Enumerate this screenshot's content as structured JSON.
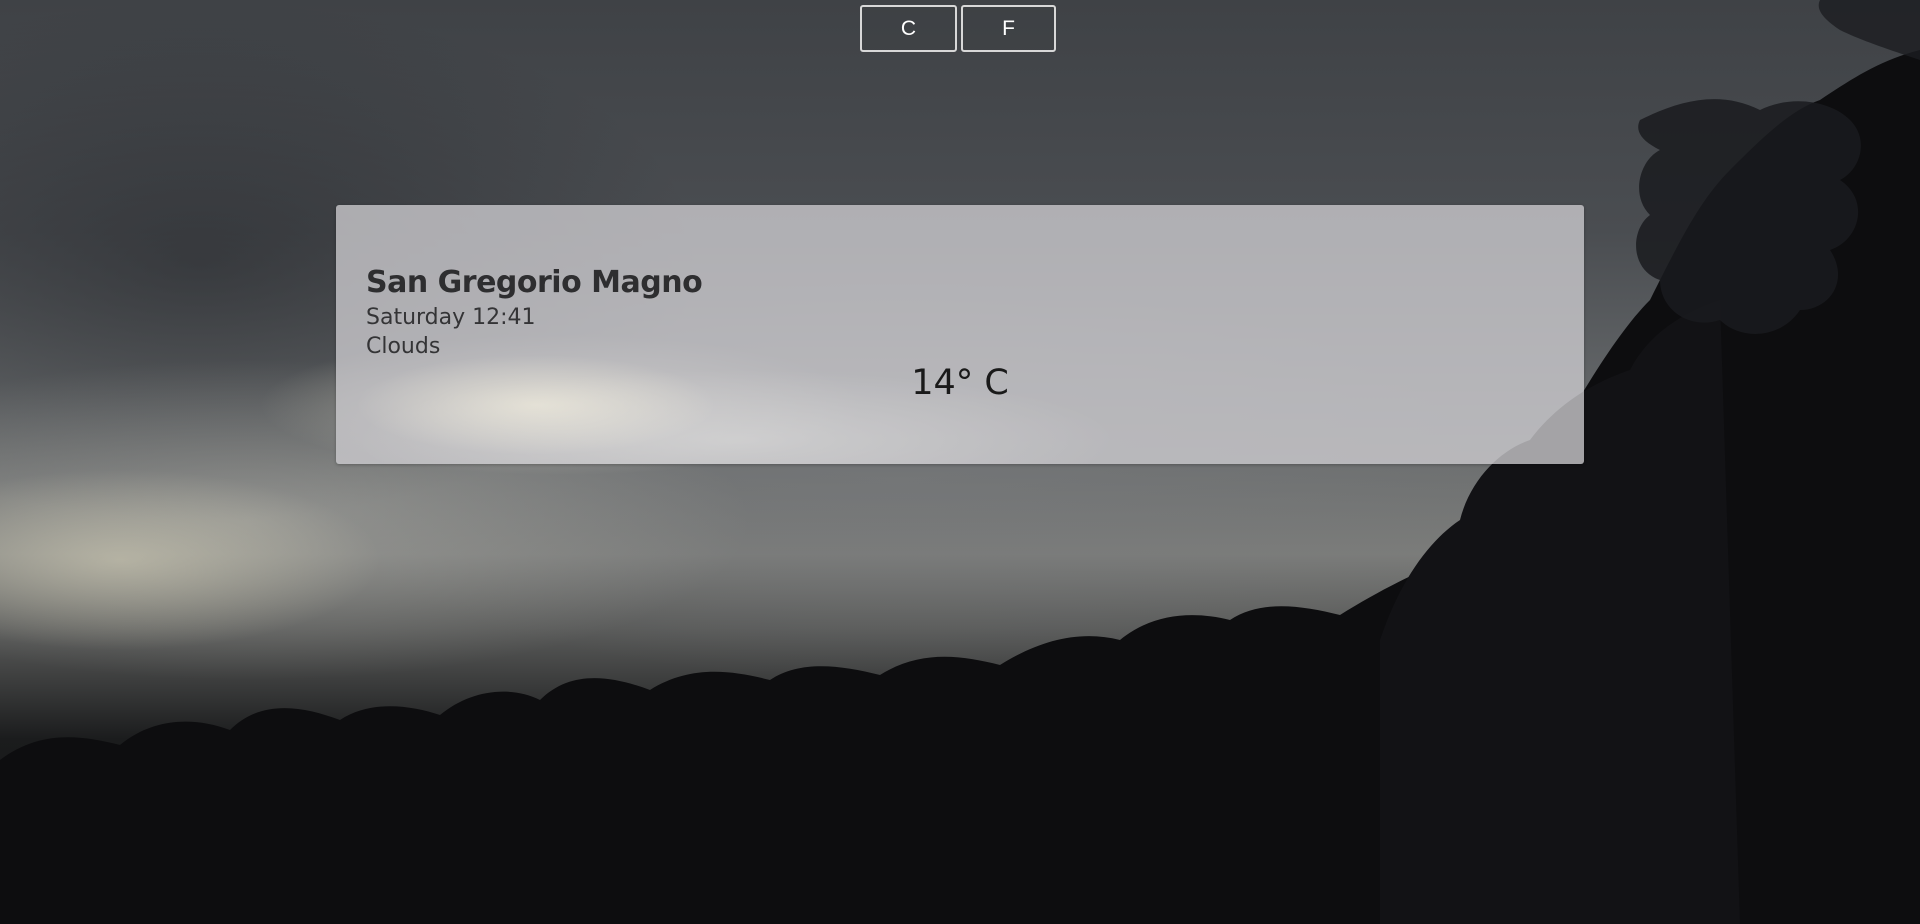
{
  "units": {
    "celsius_label": "C",
    "fahrenheit_label": "F"
  },
  "weather": {
    "city": "San Gregorio Magno",
    "datetime": "Saturday 12:41",
    "condition": "Clouds",
    "temperature": "14° C"
  },
  "background": {
    "description": "stormy sky"
  }
}
